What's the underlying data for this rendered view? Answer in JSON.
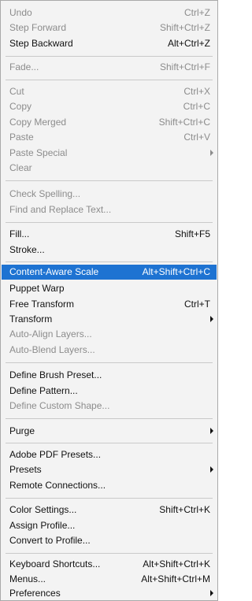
{
  "menu": {
    "items": [
      {
        "label": "Undo",
        "shortcut": "Ctrl+Z",
        "disabled": true
      },
      {
        "label": "Step Forward",
        "shortcut": "Shift+Ctrl+Z",
        "disabled": true
      },
      {
        "label": "Step Backward",
        "shortcut": "Alt+Ctrl+Z",
        "disabled": false
      },
      {
        "label": "Fade...",
        "shortcut": "Shift+Ctrl+F",
        "disabled": true
      },
      {
        "label": "Cut",
        "shortcut": "Ctrl+X",
        "disabled": true
      },
      {
        "label": "Copy",
        "shortcut": "Ctrl+C",
        "disabled": true
      },
      {
        "label": "Copy Merged",
        "shortcut": "Shift+Ctrl+C",
        "disabled": true
      },
      {
        "label": "Paste",
        "shortcut": "Ctrl+V",
        "disabled": true
      },
      {
        "label": "Paste Special",
        "shortcut": "",
        "disabled": true,
        "submenu": true
      },
      {
        "label": "Clear",
        "shortcut": "",
        "disabled": true
      },
      {
        "label": "Check Spelling...",
        "shortcut": "",
        "disabled": true
      },
      {
        "label": "Find and Replace Text...",
        "shortcut": "",
        "disabled": true
      },
      {
        "label": "Fill...",
        "shortcut": "Shift+F5",
        "disabled": false
      },
      {
        "label": "Stroke...",
        "shortcut": "",
        "disabled": false
      },
      {
        "label": "Content-Aware Scale",
        "shortcut": "Alt+Shift+Ctrl+C",
        "disabled": false,
        "selected": true
      },
      {
        "label": "Puppet Warp",
        "shortcut": "",
        "disabled": false
      },
      {
        "label": "Free Transform",
        "shortcut": "Ctrl+T",
        "disabled": false
      },
      {
        "label": "Transform",
        "shortcut": "",
        "disabled": false,
        "submenu": true
      },
      {
        "label": "Auto-Align Layers...",
        "shortcut": "",
        "disabled": true
      },
      {
        "label": "Auto-Blend Layers...",
        "shortcut": "",
        "disabled": true
      },
      {
        "label": "Define Brush Preset...",
        "shortcut": "",
        "disabled": false
      },
      {
        "label": "Define Pattern...",
        "shortcut": "",
        "disabled": false
      },
      {
        "label": "Define Custom Shape...",
        "shortcut": "",
        "disabled": true
      },
      {
        "label": "Purge",
        "shortcut": "",
        "disabled": false,
        "submenu": true
      },
      {
        "label": "Adobe PDF Presets...",
        "shortcut": "",
        "disabled": false
      },
      {
        "label": "Presets",
        "shortcut": "",
        "disabled": false,
        "submenu": true
      },
      {
        "label": "Remote Connections...",
        "shortcut": "",
        "disabled": false
      },
      {
        "label": "Color Settings...",
        "shortcut": "Shift+Ctrl+K",
        "disabled": false
      },
      {
        "label": "Assign Profile...",
        "shortcut": "",
        "disabled": false
      },
      {
        "label": "Convert to Profile...",
        "shortcut": "",
        "disabled": false
      },
      {
        "label": "Keyboard Shortcuts...",
        "shortcut": "Alt+Shift+Ctrl+K",
        "disabled": false
      },
      {
        "label": "Menus...",
        "shortcut": "Alt+Shift+Ctrl+M",
        "disabled": false
      },
      {
        "label": "Preferences",
        "shortcut": "",
        "disabled": false,
        "submenu": true
      }
    ]
  },
  "colors": {
    "selection": "#1e73d2",
    "menu_background": "#f3f3f3",
    "disabled_text": "#8c8c8c"
  }
}
